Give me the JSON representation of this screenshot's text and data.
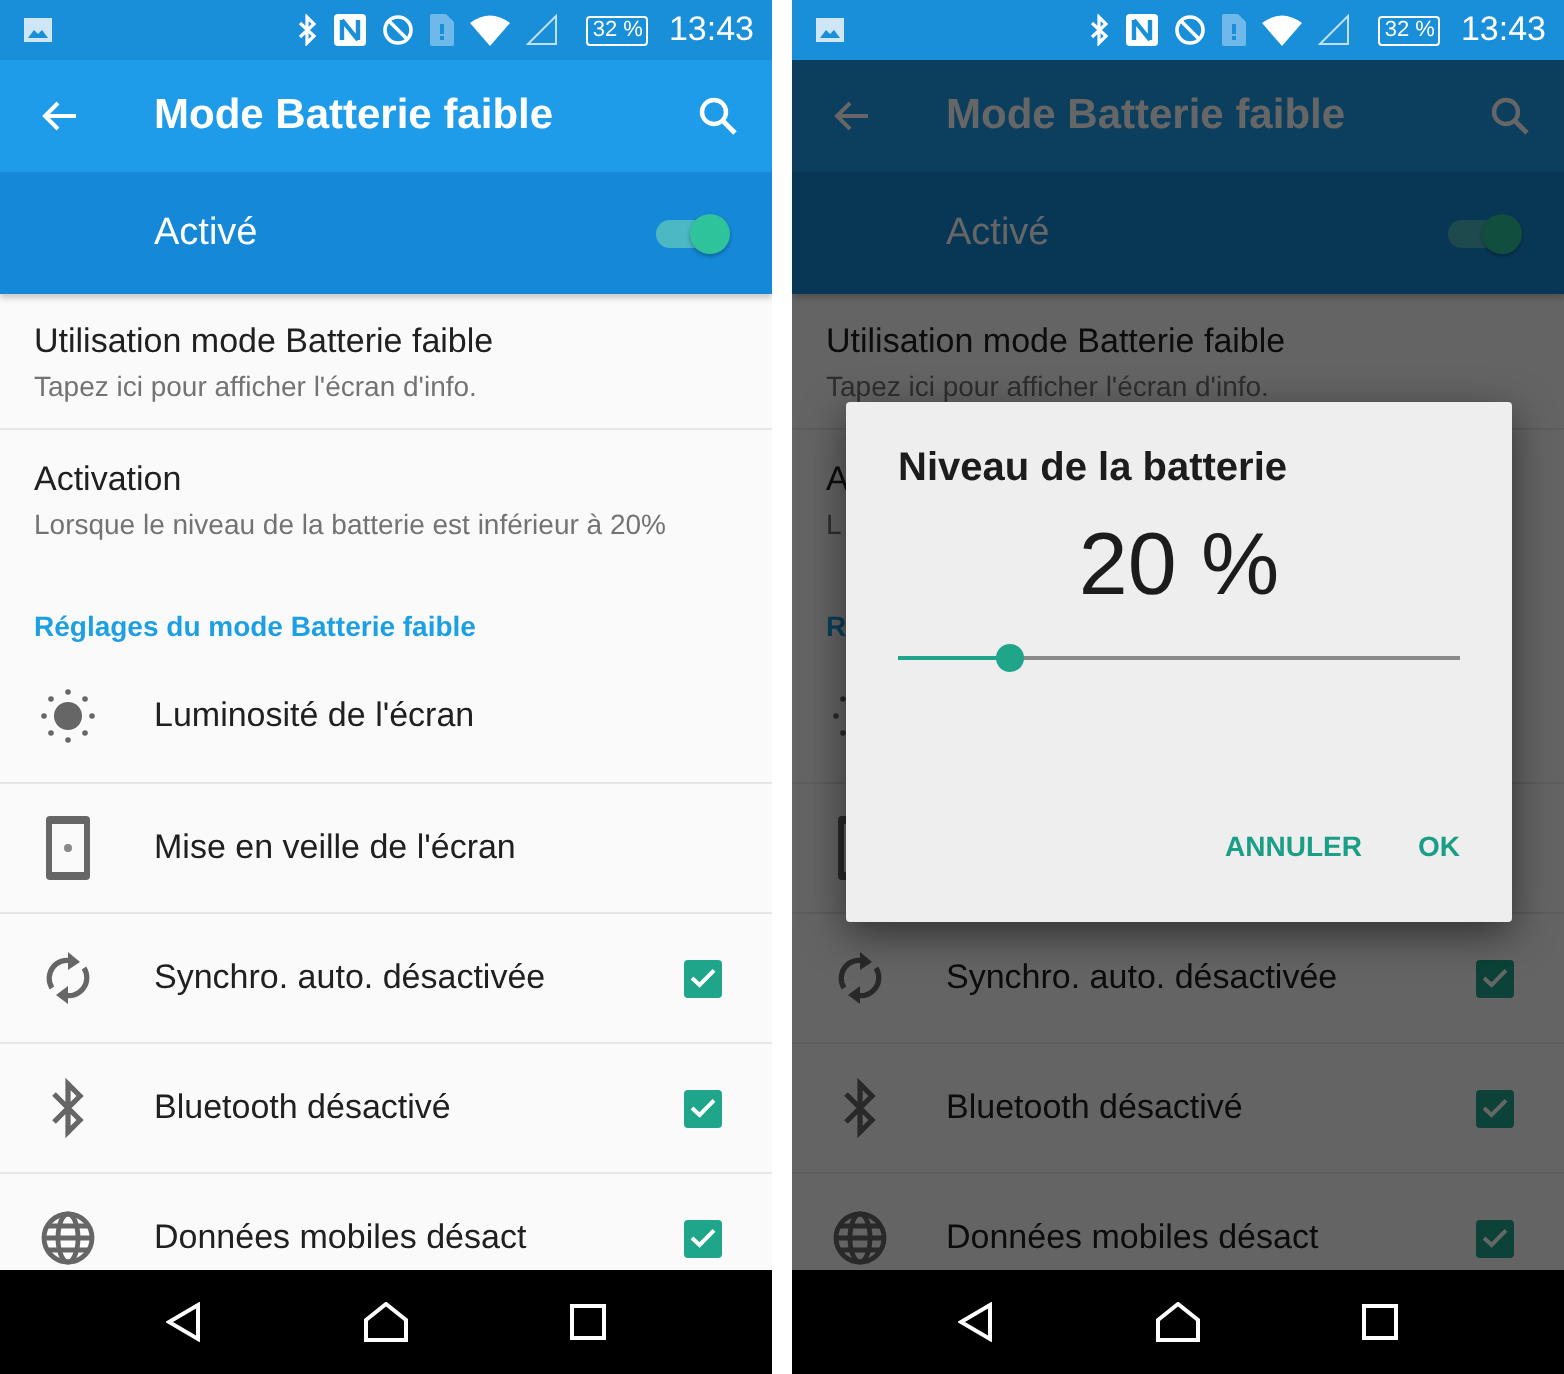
{
  "screens": [
    {
      "status_bar": {
        "battery": "32 %",
        "time": "13:43"
      },
      "toolbar": {
        "title": "Mode Batterie faible"
      },
      "master_switch": {
        "label": "Activé",
        "on": true
      },
      "items": [
        {
          "kind": "info",
          "title": "Utilisation mode Batterie faible",
          "subtitle": "Tapez ici pour afficher l'écran d'info."
        },
        {
          "kind": "info",
          "title": "Activation",
          "subtitle": "Lorsque le niveau de la batterie est inférieur à 20%"
        },
        {
          "kind": "header",
          "title": "Réglages du mode Batterie faible"
        },
        {
          "kind": "link",
          "title": "Luminosité de l'écran"
        },
        {
          "kind": "link",
          "title": "Mise en veille de l'écran"
        },
        {
          "kind": "check",
          "title": "Synchro. auto. désactivée",
          "checked": true
        },
        {
          "kind": "check",
          "title": "Bluetooth désactivé",
          "checked": true
        },
        {
          "kind": "check",
          "title": "Données mobiles désact",
          "checked": true
        }
      ]
    },
    {
      "status_bar": {
        "battery": "32 %",
        "time": "13:43"
      },
      "toolbar": {
        "title": "Mode Batterie faible"
      },
      "master_switch": {
        "label": "Activé",
        "on": true
      },
      "items": [
        {
          "kind": "info",
          "title": "Utilisation mode Batterie faible",
          "subtitle": "Tapez ici pour afficher l'écran d'info."
        },
        {
          "kind": "info",
          "title": "A",
          "subtitle": "L"
        },
        {
          "kind": "header",
          "title": "R"
        },
        {
          "kind": "link"
        },
        {
          "kind": "link"
        },
        {
          "kind": "check",
          "title": "Synchro. auto. désactivée",
          "checked": true
        },
        {
          "kind": "check",
          "title": "Bluetooth désactivé",
          "checked": true
        },
        {
          "kind": "check",
          "title": "Données mobiles désact",
          "checked": true
        }
      ],
      "dialog": {
        "title": "Niveau de la batterie",
        "value": "20 %",
        "level": 0.2,
        "buttons": [
          "ANNULER",
          "OK"
        ]
      }
    }
  ]
}
